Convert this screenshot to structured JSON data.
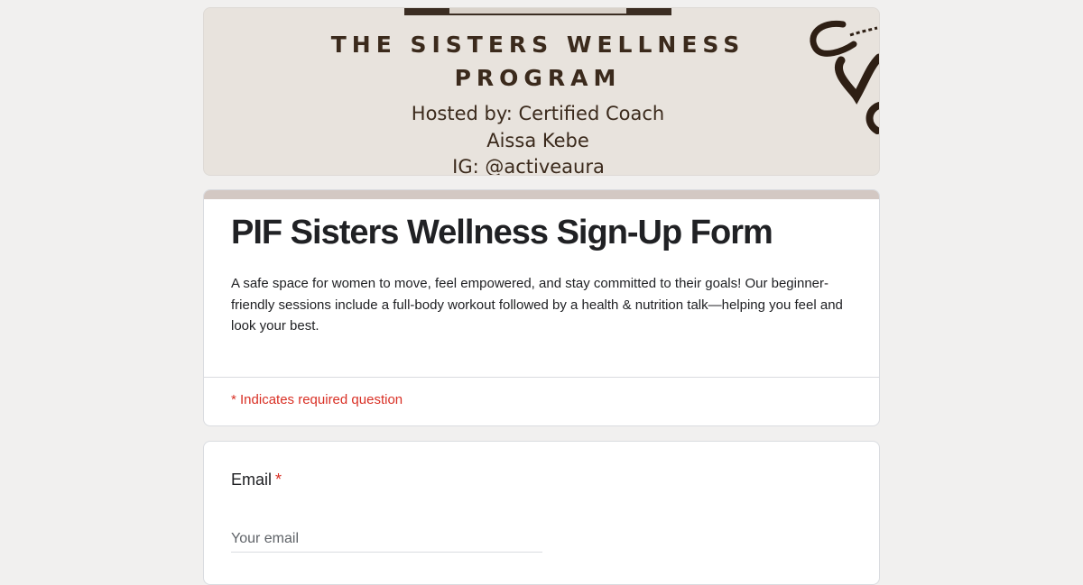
{
  "banner": {
    "title_line1": "THE SISTERS WELLNESS",
    "title_line2": "PROGRAM",
    "host_line1": "Hosted by: Certified Coach",
    "host_line2": "Aissa Kebe",
    "host_line3": "IG: @activeaura__",
    "background_color": "#e8e3dd",
    "text_color": "#3b2a1c"
  },
  "form": {
    "title": "PIF Sisters Wellness Sign-Up Form",
    "description": "A safe space for women to move, feel empowered, and stay committed to their goals! Our beginner-friendly sessions include a full-body workout followed by a health & nutrition talk—helping you feel and look your best.",
    "required_note": "* Indicates required question",
    "accent_color": "#d3c8c3"
  },
  "questions": [
    {
      "label": "Email",
      "required_marker": "*",
      "placeholder": "Your email",
      "value": ""
    }
  ]
}
